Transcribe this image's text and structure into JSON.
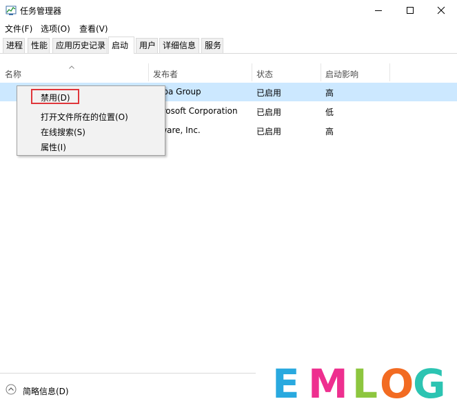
{
  "window": {
    "title": "任务管理器"
  },
  "menu": [
    {
      "label": "文件(F)"
    },
    {
      "label": "选项(O)"
    },
    {
      "label": "查看(V)"
    }
  ],
  "tabs": [
    {
      "label": "进程"
    },
    {
      "label": "性能"
    },
    {
      "label": "应用历史记录"
    },
    {
      "label": "启动",
      "active": true
    },
    {
      "label": "用户"
    },
    {
      "label": "详细信息"
    },
    {
      "label": "服务"
    }
  ],
  "columns": {
    "name": "名称",
    "publisher": "发布者",
    "status": "状态",
    "impact": "启动影响"
  },
  "rows": [
    {
      "publisher": "aba Group",
      "status": "已启用",
      "impact": "高",
      "selected": true
    },
    {
      "publisher": "crosoft Corporation",
      "status": "已启用",
      "impact": "低"
    },
    {
      "publisher": "lware, Inc.",
      "status": "已启用",
      "impact": "高"
    }
  ],
  "context_menu": [
    {
      "label": "禁用(D)",
      "highlighted": true
    },
    {
      "label": "打开文件所在的位置(O)"
    },
    {
      "label": "在线搜索(S)"
    },
    {
      "label": "属性(I)"
    }
  ],
  "footer": {
    "label": "简略信息(D)"
  },
  "watermark": {
    "letters": [
      "E",
      "M",
      "L",
      "O",
      "G"
    ],
    "colors": [
      "#29a9df",
      "#ee2f8f",
      "#8dc63f",
      "#f26b22",
      "#2cc4b2"
    ]
  }
}
